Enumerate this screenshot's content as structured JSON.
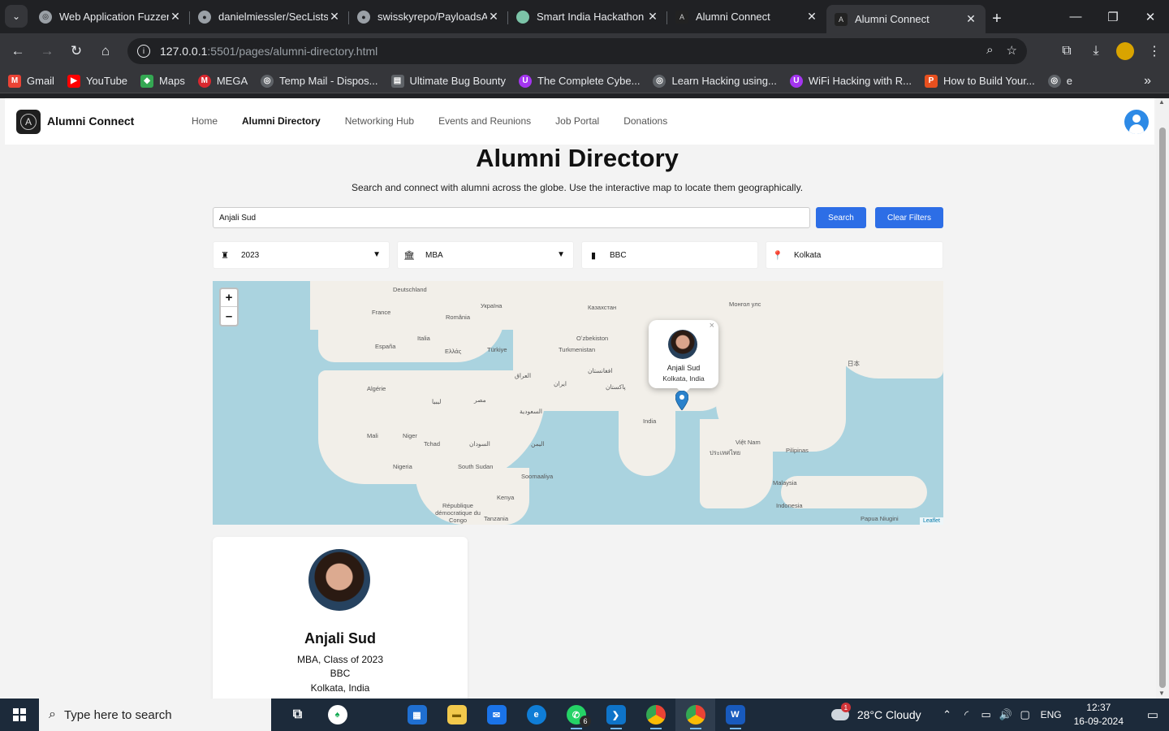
{
  "browser": {
    "tabs": [
      {
        "title": "Web Application Fuzzer",
        "icon": "globe-icon",
        "active": false
      },
      {
        "title": "danielmiessler/SecLists",
        "icon": "github-icon",
        "active": false
      },
      {
        "title": "swisskyrepo/PayloadsAl",
        "icon": "github-icon",
        "active": false
      },
      {
        "title": "Smart India Hackathon",
        "icon": "balloon-icon",
        "active": false
      },
      {
        "title": "Alumni Connect",
        "icon": "alumni-icon",
        "active": false
      },
      {
        "title": "Alumni Connect",
        "icon": "alumni-icon",
        "active": true
      }
    ],
    "url_host": "127.0.0.1",
    "url_path": ":5501/pages/alumni-directory.html",
    "bookmarks": [
      {
        "label": "Gmail",
        "color": "#ea4335"
      },
      {
        "label": "YouTube",
        "color": "#ff0000"
      },
      {
        "label": "Maps",
        "color": "#34a853"
      },
      {
        "label": "MEGA",
        "color": "#d9272e"
      },
      {
        "label": "Temp Mail - Dispos...",
        "color": "#5f6368"
      },
      {
        "label": "Ultimate Bug Bounty",
        "color": "#5f6368"
      },
      {
        "label": "The Complete Cybe...",
        "color": "#a435f0"
      },
      {
        "label": "Learn Hacking using...",
        "color": "#5f6368"
      },
      {
        "label": "WiFi Hacking with R...",
        "color": "#a435f0"
      },
      {
        "label": "How to Build Your...",
        "color": "#e8501f"
      },
      {
        "label": "e",
        "color": "#5f6368"
      }
    ]
  },
  "site": {
    "brand": "Alumni Connect",
    "nav": [
      "Home",
      "Alumni Directory",
      "Networking Hub",
      "Events and Reunions",
      "Job Portal",
      "Donations"
    ],
    "active_nav": "Alumni Directory"
  },
  "page": {
    "title": "Alumni Directory",
    "subtitle": "Search and connect with alumni across the globe. Use the interactive map to locate them geographically.",
    "search_value": "Anjali Sud",
    "search_button": "Search",
    "clear_button": "Clear Filters",
    "filters": {
      "year": "2023",
      "degree": "MBA",
      "company": "BBC",
      "location": "Kolkata"
    }
  },
  "map": {
    "zoom_in": "+",
    "zoom_out": "–",
    "attribution": "Leaflet",
    "popup": {
      "name": "Anjali Sud",
      "location": "Kolkata, India",
      "close": "×"
    },
    "labels": [
      {
        "t": "Deutschland"
      },
      {
        "t": "Україна"
      },
      {
        "t": "Казахстан"
      },
      {
        "t": "Монгол улс"
      },
      {
        "t": "France"
      },
      {
        "t": "România"
      },
      {
        "t": "Italia"
      },
      {
        "t": "España"
      },
      {
        "t": "Ελλάς"
      },
      {
        "t": "Türkiye"
      },
      {
        "t": "Oʻzbekiston"
      },
      {
        "t": "Turkmenistan"
      },
      {
        "t": "العراق"
      },
      {
        "t": "افغانستان"
      },
      {
        "t": "ایران"
      },
      {
        "t": "پاکستان"
      },
      {
        "t": "Algérie"
      },
      {
        "t": "ليبيا"
      },
      {
        "t": "مصر"
      },
      {
        "t": "السعودية"
      },
      {
        "t": "India"
      },
      {
        "t": "Mali"
      },
      {
        "t": "Niger"
      },
      {
        "t": "Tchad"
      },
      {
        "t": "السودان"
      },
      {
        "t": "اليمن"
      },
      {
        "t": "Nigeria"
      },
      {
        "t": "South Sudan"
      },
      {
        "t": "Soomaaliya"
      },
      {
        "t": "Kenya"
      },
      {
        "t": "République démocratique du Congo"
      },
      {
        "t": "Tanzania"
      },
      {
        "t": "Việt Nam"
      },
      {
        "t": "Pilipinas"
      },
      {
        "t": "Malaysia"
      },
      {
        "t": "Indonesia"
      },
      {
        "t": "Papua Niugini"
      },
      {
        "t": "日本"
      },
      {
        "t": "ประเทศไทย"
      }
    ]
  },
  "card": {
    "name": "Anjali Sud",
    "line1": "MBA, Class of 2023",
    "line2": "BBC",
    "line3": "Kolkata, India"
  },
  "taskbar": {
    "search_placeholder": "Type here to search",
    "whatsapp_badge": "6",
    "weather": "28°C  Cloudy",
    "weather_badge": "1",
    "lang": "ENG",
    "time": "12:37",
    "date": "16-09-2024"
  }
}
